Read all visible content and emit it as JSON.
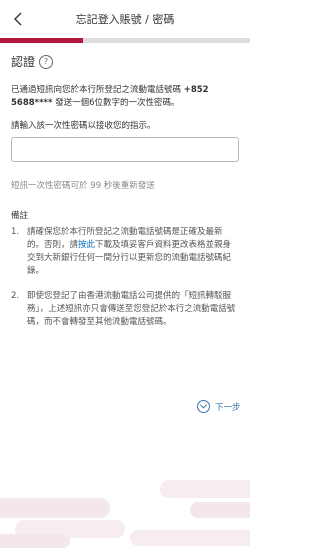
{
  "header": {
    "title": "忘記登入賬號 / 密碼",
    "back_icon": "chevron-left-icon"
  },
  "progress": {
    "value": 0.33,
    "color": "#b5163b"
  },
  "verify": {
    "title": "認證",
    "help_icon_glyph": "?",
    "info_prefix": "已通過短訊向您於本行所登記之流動電話號碼",
    "info_phone": "+852 5688****",
    "info_suffix": "發送一個6位數字的一次性密碼。",
    "instruction": "請輸入該一次性密碼以接收您的指示。",
    "input_value": "",
    "input_placeholder": "",
    "resend_text": "短訊一次性密碼可於 99 秒後重新發送"
  },
  "notes": {
    "title": "備註",
    "items": [
      {
        "num": "1.",
        "text_before": "請確保您於本行所登記之流動電話號碼是正確及最新的。否則，請",
        "link": "按此",
        "text_after": "下載及填妥客戶資料更改表格並親身交到大新銀行任何一間分行以更新您的流動電話號碼紀錄。"
      },
      {
        "num": "2.",
        "text_before": "即使您登記了由香港流動電話公司提供的「短訊轉駁服務」，上述短訊亦只會傳送至您登記於本行之流動電話號碼，而不會轉發至其他流動電話號碼。",
        "link": "",
        "text_after": ""
      }
    ]
  },
  "next": {
    "label": "下一步",
    "icon": "chevron-down-circle-icon"
  },
  "colors": {
    "accent": "#b5163b",
    "link": "#0a6ebd",
    "next": "#3b6fa8",
    "decor": "#f3e6ec"
  }
}
